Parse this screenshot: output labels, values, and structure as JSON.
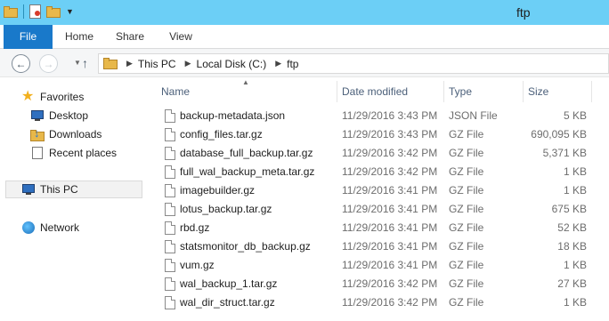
{
  "window": {
    "title": "ftp",
    "colors": {
      "titlebar": "#6ccff6",
      "file_tab": "#1979ca"
    }
  },
  "quick_access": [
    {
      "icon": "folder-icon"
    },
    {
      "icon": "properties-icon"
    },
    {
      "icon": "new-folder-icon"
    },
    {
      "icon": "customize-dropdown-icon"
    }
  ],
  "ribbon": {
    "tabs": [
      "File",
      "Home",
      "Share",
      "View"
    ]
  },
  "address": {
    "breadcrumbs": [
      "This PC",
      "Local Disk (C:)",
      "ftp"
    ]
  },
  "nav_pane": {
    "favorites": "Favorites",
    "favorites_items": [
      "Desktop",
      "Downloads",
      "Recent places"
    ],
    "this_pc": "This PC",
    "network": "Network"
  },
  "file_list": {
    "columns": [
      "Name",
      "Date modified",
      "Type",
      "Size"
    ],
    "sorted_by": "Name",
    "rows": [
      {
        "name": "backup-metadata.json",
        "date": "11/29/2016 3:43 PM",
        "type": "JSON File",
        "size": "5 KB"
      },
      {
        "name": "config_files.tar.gz",
        "date": "11/29/2016 3:43 PM",
        "type": "GZ File",
        "size": "690,095 KB"
      },
      {
        "name": "database_full_backup.tar.gz",
        "date": "11/29/2016 3:42 PM",
        "type": "GZ File",
        "size": "5,371 KB"
      },
      {
        "name": "full_wal_backup_meta.tar.gz",
        "date": "11/29/2016 3:42 PM",
        "type": "GZ File",
        "size": "1 KB"
      },
      {
        "name": "imagebuilder.gz",
        "date": "11/29/2016 3:41 PM",
        "type": "GZ File",
        "size": "1 KB"
      },
      {
        "name": "lotus_backup.tar.gz",
        "date": "11/29/2016 3:41 PM",
        "type": "GZ File",
        "size": "675 KB"
      },
      {
        "name": "rbd.gz",
        "date": "11/29/2016 3:41 PM",
        "type": "GZ File",
        "size": "52 KB"
      },
      {
        "name": "statsmonitor_db_backup.gz",
        "date": "11/29/2016 3:41 PM",
        "type": "GZ File",
        "size": "18 KB"
      },
      {
        "name": "vum.gz",
        "date": "11/29/2016 3:41 PM",
        "type": "GZ File",
        "size": "1 KB"
      },
      {
        "name": "wal_backup_1.tar.gz",
        "date": "11/29/2016 3:42 PM",
        "type": "GZ File",
        "size": "27 KB"
      },
      {
        "name": "wal_dir_struct.tar.gz",
        "date": "11/29/2016 3:42 PM",
        "type": "GZ File",
        "size": "1 KB"
      }
    ]
  }
}
